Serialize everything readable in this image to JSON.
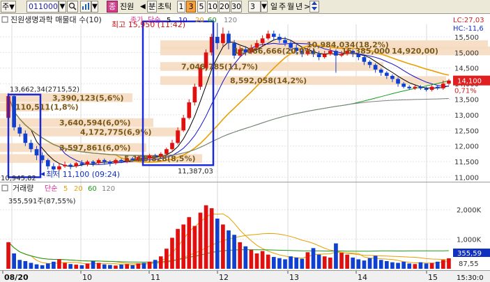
{
  "toolbar": {
    "mode_label": "주",
    "mode_arrow": "▼",
    "stock_code": "011000",
    "code_arrow": "▼",
    "search_icon": "search-icon",
    "chart_icon": "chart-icon",
    "mini_dropdown": "▼",
    "info_badge": "종",
    "stock_name_short": "진원",
    "prev_arrow": "◀",
    "period_unit": "분",
    "tick_label": "초틱",
    "intervals": [
      "1",
      "3",
      "5",
      "10",
      "20",
      "30"
    ],
    "selected_interval": "3",
    "count_value": "3",
    "count_arrow": "▼",
    "period_buttons": [
      "일",
      "주",
      "월",
      "년"
    ],
    "next_arrow": ">",
    "sort_icon": "up-down-arrow-icon"
  },
  "price_panel": {
    "title": "진원생명과학 매물대 수(10)",
    "legend_prefix": "종가",
    "legend_ma_label": "단순",
    "legend_ma_periods": [
      "5",
      "10",
      "20",
      "60",
      "120"
    ],
    "legend_ma_colors": [
      "#000000",
      "#1010d0",
      "#e8a000",
      "#1a9a1a",
      "#808080"
    ],
    "lc_label": "LC:27,03",
    "hc_label": "HC:-11,6",
    "y_ticks": [
      "15,500",
      "15,000",
      "14,500",
      "14,000",
      "13,500",
      "13,000",
      "12,500",
      "12,000",
      "11,500",
      "11,000"
    ],
    "current_price": "14,100",
    "current_change": "0,71%",
    "high_annotation": "최고 15,950 (11:42)",
    "low_annotation": "최저 11,100 (09:24)",
    "low_value_label": "10,945,82",
    "high_value_label": "13,662,34(2715,52)",
    "volume_profile": [
      {
        "label": "10,984,034(18,2%)",
        "price": 15250
      },
      {
        "label": "12,066,666(20,0%)",
        "price": 15050
      },
      {
        "label": "15,385,000",
        "price": 15050
      },
      {
        "label": "14,920,00)",
        "price": 15050
      },
      {
        "label": "7,048,785(11,7%)",
        "price": 14550
      },
      {
        "label": "8,592,058(14,2%)",
        "price": 14100
      },
      {
        "label": "3,390,123(5,6%)",
        "price": 13550
      },
      {
        "label": "110,511(1,8%)",
        "price": 13250
      },
      {
        "label": "3,640,594(6,0%)",
        "price": 12750
      },
      {
        "label": "4,172,775(6,9%)",
        "price": 12450
      },
      {
        "label": "3,597,861(6,0%)",
        "price": 11950
      },
      {
        "label": "5,168,828(8,5%)",
        "price": 11600
      }
    ],
    "annot_11387": "11,387,03"
  },
  "volume_panel": {
    "title": "거래량",
    "legend_ma_label": "단순",
    "legend_ma_periods": [
      "5",
      "20",
      "60",
      "120"
    ],
    "legend_ma_colors": [
      "#e8a000",
      "#e8a000",
      "#1a9a1a",
      "#808080"
    ],
    "current_volume": "355,591주(87,55%)",
    "y_ticks": [
      "2,000K",
      "1,000K"
    ],
    "right_label_1": "355,59",
    "right_label_2": "87,55"
  },
  "date_axis": {
    "labels": [
      "08/20",
      "10",
      "11",
      "12",
      "13",
      "14",
      "15"
    ],
    "right_time": "15:30:0"
  },
  "chart_data": {
    "type": "candlestick",
    "title": "진원생명과학 매물대 수(10)",
    "ylim": [
      10900,
      15900
    ],
    "current_price": 14100,
    "high": {
      "value": 15950,
      "time": "11:42"
    },
    "low": {
      "value": 11100,
      "time": "09:24"
    },
    "candles": [
      [
        12900,
        13600,
        12850,
        13700
      ],
      [
        13600,
        12600,
        12500,
        13650
      ],
      [
        12600,
        12400,
        12300,
        12700
      ],
      [
        12400,
        12100,
        12000,
        12500
      ],
      [
        12100,
        11900,
        11800,
        12200
      ],
      [
        11900,
        11700,
        11550,
        12000
      ],
      [
        11700,
        11550,
        11450,
        11800
      ],
      [
        11550,
        11350,
        11250,
        11600
      ],
      [
        11350,
        11250,
        11100,
        11450
      ],
      [
        11250,
        11350,
        11200,
        11450
      ],
      [
        11350,
        11400,
        11300,
        11500
      ],
      [
        11400,
        11350,
        11250,
        11450
      ],
      [
        11350,
        11450,
        11300,
        11500
      ],
      [
        11450,
        11400,
        11350,
        11550
      ],
      [
        11400,
        11500,
        11350,
        11550
      ],
      [
        11500,
        11450,
        11350,
        11550
      ],
      [
        11450,
        11550,
        11400,
        11600
      ],
      [
        11550,
        11500,
        11400,
        11600
      ],
      [
        11500,
        11450,
        11350,
        11550
      ],
      [
        11450,
        11550,
        11400,
        11600
      ],
      [
        11550,
        11500,
        11450,
        11600
      ],
      [
        11500,
        11600,
        11450,
        11650
      ],
      [
        11600,
        11550,
        11500,
        11650
      ],
      [
        11550,
        11650,
        11500,
        11700
      ],
      [
        11650,
        11600,
        11500,
        11700
      ],
      [
        11600,
        11700,
        11550,
        11750
      ],
      [
        11700,
        11650,
        11550,
        11750
      ],
      [
        11650,
        11750,
        11600,
        11800
      ],
      [
        11750,
        11900,
        11700,
        11950
      ],
      [
        11900,
        12100,
        11850,
        12200
      ],
      [
        12100,
        12500,
        12050,
        12600
      ],
      [
        12500,
        12900,
        12450,
        13000
      ],
      [
        12900,
        13400,
        12850,
        13500
      ],
      [
        13400,
        13900,
        13300,
        14000
      ],
      [
        13900,
        14500,
        13800,
        14600
      ],
      [
        14500,
        15000,
        14400,
        15100
      ],
      [
        15000,
        15500,
        14900,
        15600
      ],
      [
        15500,
        15300,
        15100,
        15950
      ],
      [
        15300,
        15600,
        15200,
        15800
      ],
      [
        15600,
        15300,
        15100,
        15700
      ],
      [
        15300,
        14900,
        14800,
        15400
      ],
      [
        14900,
        15100,
        14850,
        15200
      ],
      [
        15100,
        15000,
        14900,
        15200
      ],
      [
        15000,
        15150,
        14950,
        15250
      ],
      [
        15150,
        15300,
        15100,
        15400
      ],
      [
        15300,
        15450,
        15200,
        15550
      ],
      [
        15450,
        15600,
        15400,
        15700
      ],
      [
        15600,
        15500,
        15400,
        15700
      ],
      [
        15500,
        15400,
        15300,
        15600
      ],
      [
        15400,
        15300,
        15200,
        15500
      ],
      [
        15300,
        15150,
        15050,
        15400
      ],
      [
        15150,
        15050,
        14950,
        15250
      ],
      [
        15050,
        14950,
        14850,
        15150
      ],
      [
        14950,
        15050,
        14900,
        15150
      ],
      [
        15050,
        14950,
        14850,
        15100
      ],
      [
        14950,
        14850,
        14750,
        15050
      ],
      [
        14850,
        14950,
        14800,
        15050
      ],
      [
        14950,
        15050,
        14900,
        15150
      ],
      [
        15050,
        14900,
        14350,
        15100
      ],
      [
        14900,
        14950,
        14850,
        15050
      ],
      [
        14950,
        15050,
        14900,
        15100
      ],
      [
        15050,
        14950,
        14850,
        15100
      ],
      [
        14950,
        14850,
        14750,
        15000
      ],
      [
        14850,
        14700,
        14600,
        14900
      ],
      [
        14700,
        14600,
        14500,
        14750
      ],
      [
        14600,
        14450,
        14350,
        14650
      ],
      [
        14450,
        14350,
        14250,
        14500
      ],
      [
        14350,
        14250,
        14150,
        14400
      ],
      [
        14250,
        14150,
        14050,
        14300
      ],
      [
        14150,
        14000,
        13900,
        14200
      ],
      [
        14000,
        13900,
        13850,
        14050
      ],
      [
        13900,
        13850,
        13800,
        13950
      ],
      [
        13850,
        13900,
        13800,
        13950
      ],
      [
        13900,
        13850,
        13800,
        13950
      ],
      [
        13850,
        13800,
        13750,
        13900
      ],
      [
        13800,
        13900,
        13750,
        13950
      ],
      [
        13900,
        13850,
        13800,
        13950
      ],
      [
        13850,
        14000,
        13800,
        14100
      ],
      [
        14000,
        14100,
        13950,
        14150
      ]
    ],
    "volumes": [
      900,
      520,
      300,
      260,
      200,
      150,
      120,
      180,
      240,
      320,
      200,
      160,
      140,
      120,
      180,
      260,
      200,
      150,
      130,
      110,
      140,
      160,
      120,
      180,
      200,
      240,
      300,
      420,
      680,
      1050,
      1350,
      1500,
      1750,
      1450,
      1900,
      2150,
      2050,
      1700,
      1500,
      1300,
      1150,
      900,
      760,
      640,
      520,
      600,
      480,
      400,
      360,
      320,
      420,
      380,
      340,
      560,
      700,
      480,
      420,
      380,
      860,
      540,
      480,
      380,
      320,
      280,
      360,
      440,
      300,
      260,
      220,
      200,
      240,
      180,
      160,
      220,
      180,
      200,
      240,
      300,
      355
    ],
    "volume_ylim": [
      0,
      2500
    ]
  }
}
